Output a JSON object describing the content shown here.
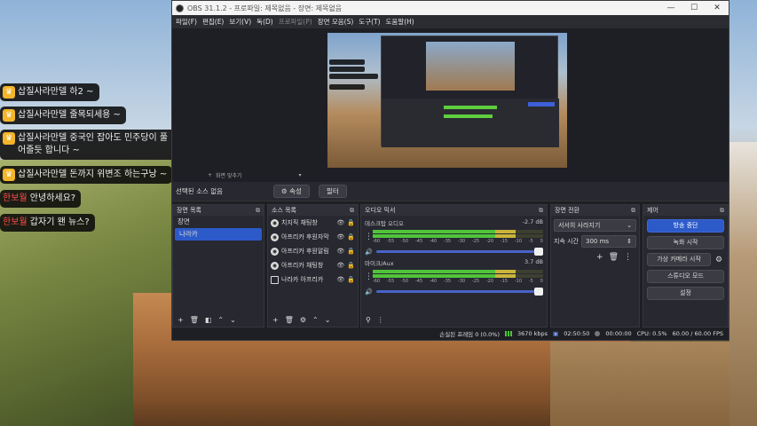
{
  "chat": [
    {
      "name": "삽질사라만델",
      "text": " 하2 ~",
      "badge": "crown-icon"
    },
    {
      "name": "삽질사라만델",
      "text": " 줄목되세용 ~",
      "badge": "crown-icon"
    },
    {
      "name": "삽질사라만델",
      "text": " 중국인 잡아도 민주당이 풀",
      "text2": "어줄듯 합니다 ~",
      "badge": "crown-icon"
    },
    {
      "name": "삽질사라만델",
      "text": " 돈까지 위변조 하는구낭 ~",
      "badge": "crown-icon"
    },
    {
      "name": "한보월",
      "text": " 안녕하세요?"
    },
    {
      "name": "한보월",
      "text": " 갑자기 왠 뉴스?"
    }
  ],
  "window": {
    "title": "OBS 31.1.2 - 프로파일: 제목없음 - 장면: 제목없음",
    "min": "—",
    "max": "☐",
    "close": "✕"
  },
  "menu": [
    "파일(F)",
    "편집(E)",
    "보기(V)",
    "독(D)",
    "프로파일(P)",
    "장면 모음(S)",
    "도구(T)",
    "도움말(H)"
  ],
  "scene_bar": {
    "label": "화면 맞추기"
  },
  "source_bar": {
    "label": "선택된 소스 없음",
    "props": "⚙ 속성",
    "filters": "필터"
  },
  "scenes": {
    "title": "장면 목록",
    "items": [
      "장면",
      "나라카"
    ]
  },
  "sources": {
    "title": "소스 목록",
    "items": [
      {
        "name": "치지직 채팅창",
        "icon": "browser-icon"
      },
      {
        "name": "아프리카 후원자막",
        "icon": "browser-icon"
      },
      {
        "name": "아프리카 후원알림",
        "icon": "browser-icon"
      },
      {
        "name": "아프리카 채팅창",
        "icon": "browser-icon"
      },
      {
        "name": "나라카 아프리카",
        "icon": "monitor-icon"
      }
    ]
  },
  "mixer": {
    "title": "오디오 믹서",
    "channels": [
      {
        "name": "데스크탑 오디오",
        "db": "-2.7 dB",
        "level": 0.86
      },
      {
        "name": "마이크/Aux",
        "db": "3.7 dB",
        "level": 0.72
      }
    ],
    "ticks": [
      "-60",
      "-55",
      "-50",
      "-45",
      "-40",
      "-35",
      "-30",
      "-25",
      "-20",
      "-15",
      "-10",
      "-5",
      "0"
    ]
  },
  "transitions": {
    "title": "장면 전환",
    "type": "서서히 사라지기",
    "duration_label": "지속 시간",
    "duration": "300 ms"
  },
  "controls": {
    "title": "제어",
    "stream": "방송 중단",
    "record": "녹화 시작",
    "vcam": "가상 카메라 시작",
    "studio": "스튜디오 모드",
    "settings": "설정"
  },
  "status": {
    "dropped": "손실된 프레임 0 (0.0%)",
    "bitrate": "3670 kbps",
    "live_time": "02:50:50",
    "rec_time": "00:00:00",
    "cpu": "CPU: 0.5%",
    "fps": "60.00 / 60.00 FPS"
  },
  "colors": {
    "accent": "#2d5ac9",
    "meter_green": "#4fc43a",
    "badge": "#f3b52b",
    "chat_red": "#ff4b4b"
  }
}
